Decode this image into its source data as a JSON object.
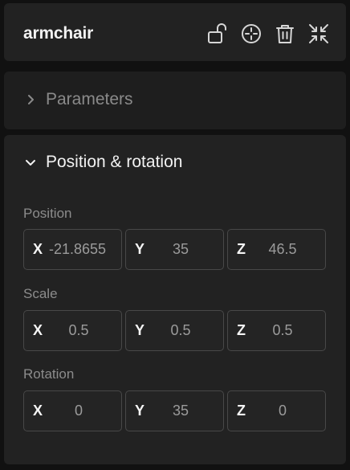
{
  "header": {
    "title": "armchair",
    "icons": [
      "lock-open-icon",
      "crosshair-icon",
      "trash-icon",
      "collapse-icon"
    ]
  },
  "parameters": {
    "label": "Parameters",
    "expanded": false
  },
  "position_rotation": {
    "label": "Position & rotation",
    "expanded": true,
    "position": {
      "label": "Position",
      "x": "-21.8655",
      "y": "35",
      "z": "46.5"
    },
    "scale": {
      "label": "Scale",
      "x": "0.5",
      "y": "0.5",
      "z": "0.5"
    },
    "rotation": {
      "label": "Rotation",
      "x": "0",
      "y": "35",
      "z": "0"
    },
    "axis_labels": {
      "x": "X",
      "y": "Y",
      "z": "Z"
    }
  },
  "colors": {
    "background": "#111111",
    "panel": "#222222",
    "field_border": "#484848",
    "text_primary": "#f2f2f2",
    "text_muted": "#8c8c8c"
  }
}
